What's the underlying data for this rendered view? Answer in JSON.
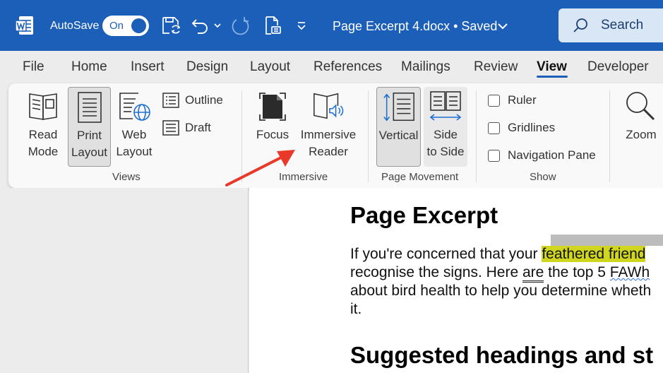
{
  "titlebar": {
    "autosave_label": "AutoSave",
    "autosave_state": "On",
    "document_title": "Page Excerpt 4.docx • Saved",
    "search_label": "Search",
    "accent_color": "#1c5fb8"
  },
  "tabs": [
    "File",
    "Home",
    "Insert",
    "Design",
    "Layout",
    "References",
    "Mailings",
    "Review",
    "View",
    "Developer"
  ],
  "active_tab": "View",
  "ribbon": {
    "views": {
      "read_mode": [
        "Read",
        "Mode"
      ],
      "print_layout": [
        "Print",
        "Layout"
      ],
      "web_layout": [
        "Web",
        "Layout"
      ],
      "outline": "Outline",
      "draft": "Draft",
      "group_label": "Views"
    },
    "immersive": {
      "focus": "Focus",
      "immersive_reader": [
        "Immersive",
        "Reader"
      ],
      "group_label": "Immersive"
    },
    "page_movement": {
      "vertical": "Vertical",
      "side_to_side": [
        "Side",
        "to Side"
      ],
      "group_label": "Page Movement"
    },
    "show": {
      "ruler": "Ruler",
      "gridlines": "Gridlines",
      "navigation_pane": "Navigation Pane",
      "group_label": "Show"
    },
    "zoom": {
      "label": "Zoom"
    }
  },
  "document": {
    "heading": "Page Excerpt",
    "para_line1_a": "If you're concerned that your ",
    "para_line1_hl": "feathered friend",
    "para_line2_a": "recognise the signs. Here ",
    "para_line2_are": "are",
    "para_line2_b": " the top 5 ",
    "para_line2_faw": "FAWh",
    "para_line3": "about bird health to help you determine wheth",
    "para_line4": "it.",
    "heading2": "Suggested headings and st"
  },
  "annotation": {
    "arrow_color": "#e8392b"
  }
}
